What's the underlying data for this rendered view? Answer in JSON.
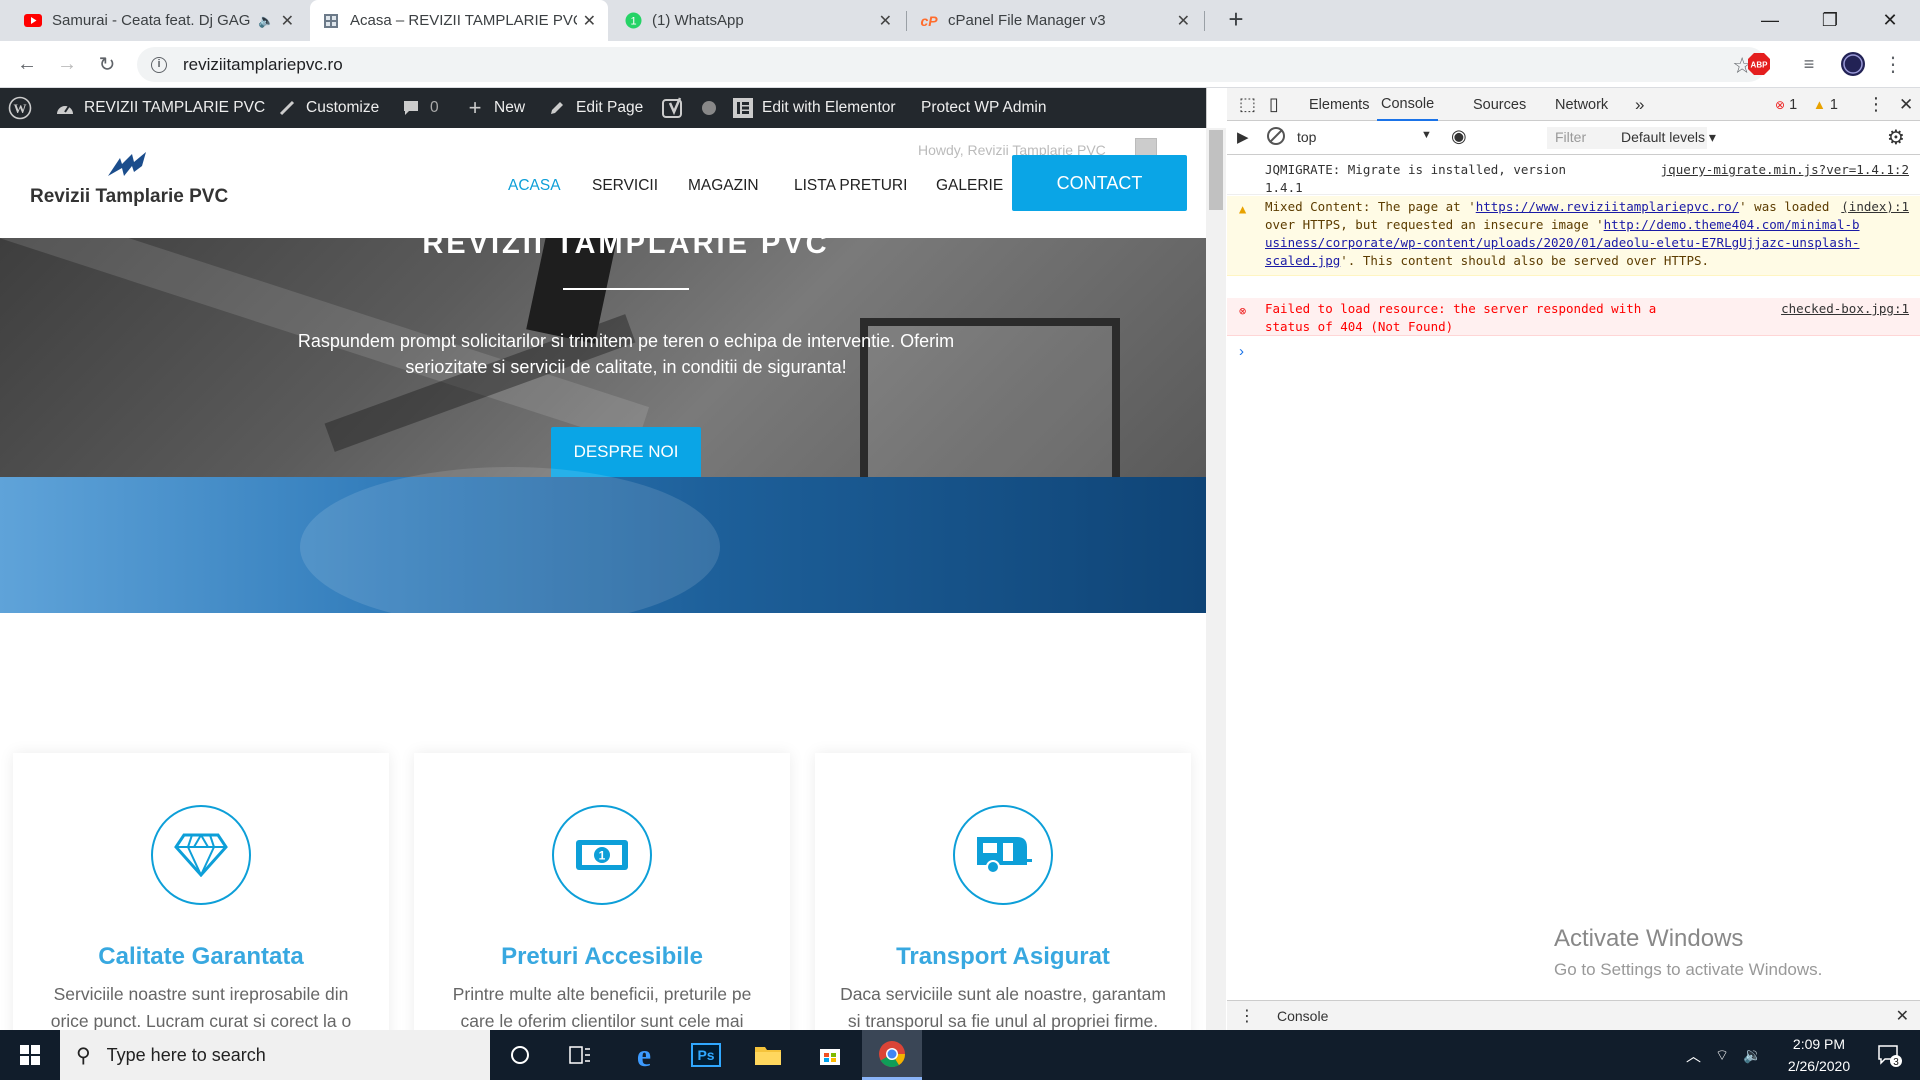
{
  "browser": {
    "tabs": [
      {
        "title": "Samurai - Ceata feat. Dj GAG",
        "icon": "youtube-icon"
      },
      {
        "title": "Acasa – REVIZII TAMPLARIE PVC",
        "icon": "site-icon"
      },
      {
        "title": "(1) WhatsApp",
        "icon": "whatsapp-icon",
        "badge": "1"
      },
      {
        "title": "cPanel File Manager v3",
        "icon": "cpanel-icon"
      }
    ],
    "url": "reviziitamplariepvc.ro",
    "ext_abp": "ABP"
  },
  "wp_admin_bar": {
    "site_name": "REVIZII TAMPLARIE PVC",
    "customize": "Customize",
    "comments_count": "0",
    "new": "New",
    "edit_page": "Edit Page",
    "elementor": "Edit with Elementor",
    "protect": "Protect WP Admin",
    "howdy": "Howdy, Revizii Tamplarie PVC"
  },
  "site": {
    "logo_text": "Revizii Tamplarie PVC",
    "menu": [
      "ACASA",
      "SERVICII",
      "MAGAZIN",
      "LISTA PRETURI",
      "GALERIE"
    ],
    "contact": "CONTACT",
    "hero": {
      "title": "REVIZII TAMPLARIE PVC",
      "text": "Raspundem prompt solicitarilor si trimitem pe teren o echipa de interventie. Oferim seriozitate si servicii de calitate, in conditii de siguranta!",
      "button": "DESPRE NOI"
    },
    "cards": [
      {
        "title": "Calitate Garantata",
        "text": "Serviciile noastre sunt ireprosabile din orice punct. Lucram curat si corect la o",
        "icon": "diamond-icon"
      },
      {
        "title": "Preturi Accesibile",
        "text": "Printre multe alte beneficii, preturile pe care le oferim clientilor sunt cele mai",
        "icon": "money-icon"
      },
      {
        "title": "Transport Asigurat",
        "text": "Daca serviciile sunt ale noastre, garantam si transporul sa fie unul al propriei firme.",
        "icon": "trailer-icon"
      }
    ],
    "accent": "#0aa5e6"
  },
  "devtools": {
    "tabs": [
      "Elements",
      "Console",
      "Sources",
      "Network"
    ],
    "more": "»",
    "error_count": "1",
    "warning_count": "1",
    "context": "top",
    "filter_placeholder": "Filter",
    "levels": "Default levels ▾",
    "logs": [
      {
        "type": "info",
        "text": "JQMIGRATE: Migrate is installed, version 1.4.1",
        "source": "jquery-migrate.min.js?ver=1.4.1:2"
      },
      {
        "type": "warn",
        "text_a": "Mixed Content: The page at '",
        "link_a": "https://www.reviziitamplariepvc.ro/",
        "text_b": "' was loaded over HTTPS, but requested an insecure image '",
        "link_b": "http://demo.theme404.com/minimal-business/corporate/wp-content/uploads/2020/01/adeolu-eletu-E7RLgUjjazc-unsplash-scaled.jpg",
        "text_c": "'. This content should also be served over HTTPS.",
        "source": "(index):1"
      },
      {
        "type": "error",
        "text": "Failed to load resource: the server responded with a status of 404 (Not Found)",
        "source": "checked-box.jpg:1"
      }
    ],
    "drawer": "Console"
  },
  "watermark": {
    "line1": "Activate Windows",
    "line2": "Go to Settings to activate Windows."
  },
  "taskbar": {
    "search": "Type here to search",
    "time": "2:09 PM",
    "date": "2/26/2020",
    "notif_count": "3",
    "ps": "Ps"
  }
}
